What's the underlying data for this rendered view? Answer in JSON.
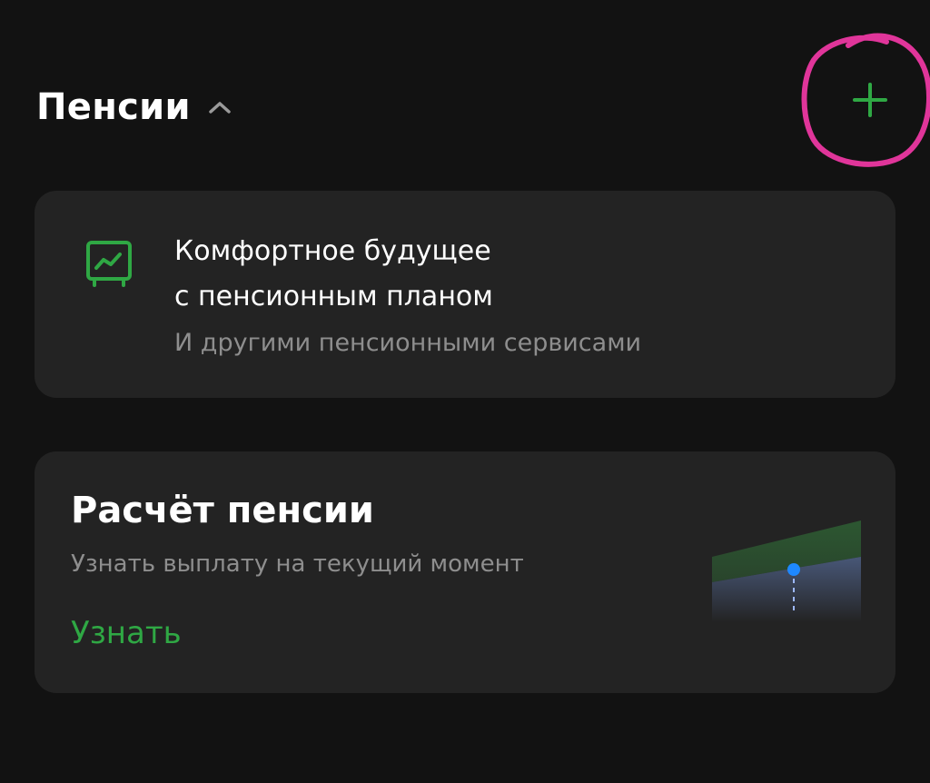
{
  "section": {
    "title": "Пенсии",
    "collapse_icon": "chevron-up-icon",
    "add_icon": "plus-icon"
  },
  "pension_plan_card": {
    "icon": "chart-monitor-icon",
    "title_line1": "Комфортное будущее",
    "title_line2": "с пенсионным планом",
    "subtitle": "И другими пенсионными сервисами"
  },
  "pension_calc_card": {
    "title": "Расчёт пенсии",
    "subtitle": "Узнать выплату на текущий момент",
    "link_label": "Узнать",
    "illustration": "pension-growth-chart-illustration"
  },
  "colors": {
    "background": "#121212",
    "card": "#232323",
    "accent_green": "#2fa844",
    "secondary_text": "#8e8e8e",
    "annotation_pink": "#e0359a",
    "chart_blue": "#1e88ff"
  }
}
